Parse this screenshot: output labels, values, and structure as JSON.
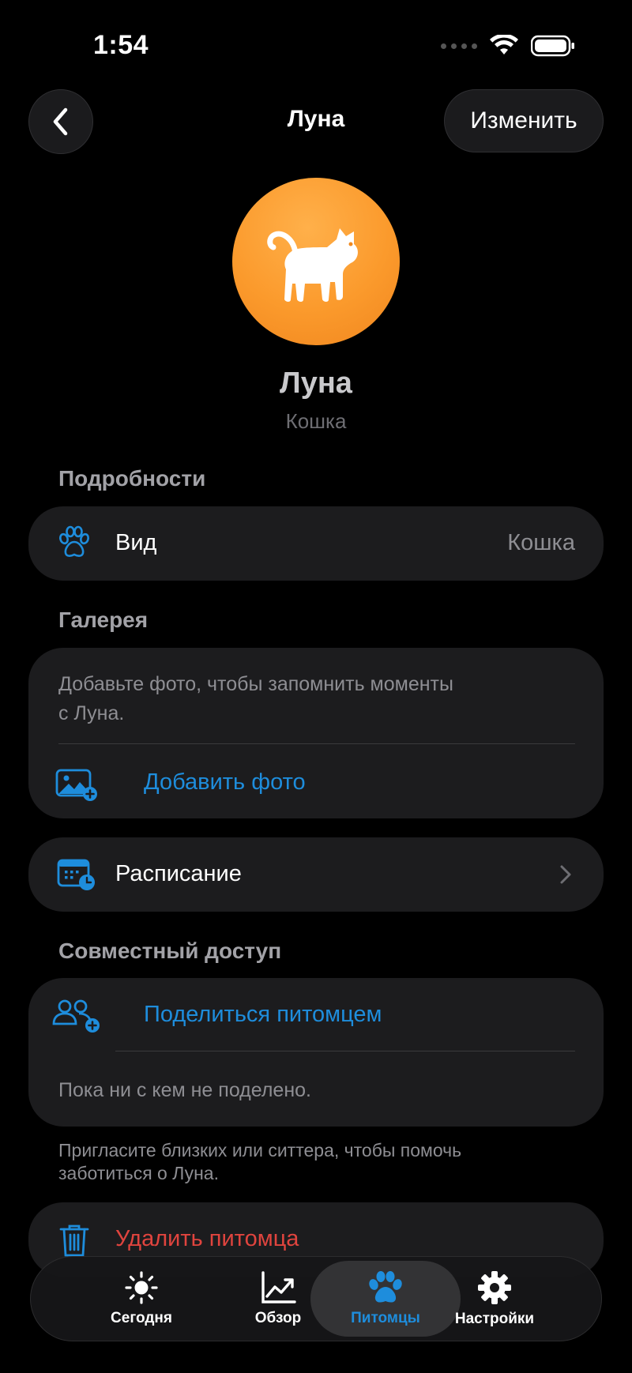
{
  "status_bar": {
    "time": "1:54"
  },
  "nav": {
    "title": "Луна",
    "edit_label": "Изменить"
  },
  "pet": {
    "name": "Луна",
    "species": "Кошка"
  },
  "details": {
    "heading": "Подробности",
    "species_label": "Вид",
    "species_value": "Кошка"
  },
  "gallery": {
    "heading": "Галерея",
    "hint_line1": "Добавьте фото, чтобы запомнить моменты",
    "hint_line2": "с Луна.",
    "add_photo_label": "Добавить фото"
  },
  "schedule": {
    "label": "Расписание"
  },
  "sharing": {
    "heading": "Совместный доступ",
    "share_label": "Поделиться питомцем",
    "empty_text": "Пока ни с кем не поделено.",
    "note_line1": "Пригласите близких или ситтера, чтобы помочь",
    "note_line2": "заботиться о Луна."
  },
  "delete": {
    "label": "Удалить питомца"
  },
  "tabbar": {
    "tabs": [
      {
        "label": "Сегодня",
        "icon": "sun-icon"
      },
      {
        "label": "Обзор",
        "icon": "chart-icon"
      },
      {
        "label": "Питомцы",
        "icon": "paw-icon",
        "active": true
      },
      {
        "label": "Настройки",
        "icon": "gear-icon"
      }
    ]
  },
  "colors": {
    "accent": "#1e8ddc",
    "destructive": "#e0443e",
    "avatar": "#fb9a2c",
    "card": "#1c1c1e"
  }
}
